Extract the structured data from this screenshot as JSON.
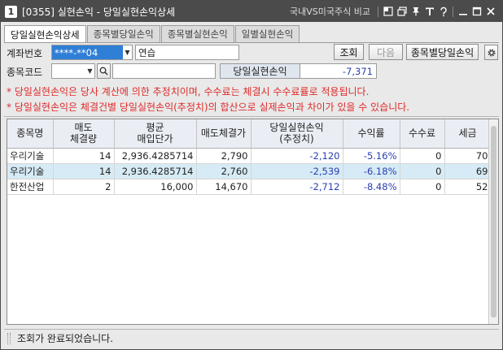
{
  "window": {
    "number": "1",
    "title": "[0355] 실현손익 - 당일실현손익상세",
    "compare_link": "국내VS미국주식 비교"
  },
  "tabs": [
    {
      "label": "당일실현손익상세",
      "active": true
    },
    {
      "label": "종목별당일손익",
      "active": false
    },
    {
      "label": "종목별실현손익",
      "active": false
    },
    {
      "label": "일별실현손익",
      "active": false
    }
  ],
  "form": {
    "account_label": "계좌번호",
    "account_value": "****-**04",
    "account_name": "연습",
    "code_label": "종목코드",
    "code_value": "",
    "code_name": "",
    "summary_label": "당일실현손익",
    "summary_value": "-7,371"
  },
  "buttons": {
    "query": "조회",
    "next": "다음",
    "by_stock": "종목별당일손익"
  },
  "notices": [
    "* 당일실현손익은 당사 계산에 의한 추정치이며, 수수료는 체결시 수수료률로 적용됩니다.",
    "* 당일실현손익은 체결건별 당일실현손익(추정치)의 합산으로 실제손익과 차이가 있을 수 있습니다."
  ],
  "table": {
    "headers": [
      [
        "종목명"
      ],
      [
        "매도",
        "체결량"
      ],
      [
        "평균",
        "매입단가"
      ],
      [
        "매도체결가"
      ],
      [
        "당일실현손익",
        "(추정치)"
      ],
      [
        "수익률"
      ],
      [
        "수수료"
      ],
      [
        "세금"
      ]
    ],
    "rows": [
      [
        "우리기술",
        "14",
        "2,936.4285714",
        "2,790",
        "-2,120",
        "-5.16%",
        "0",
        "70"
      ],
      [
        "우리기술",
        "14",
        "2,936.4285714",
        "2,760",
        "-2,539",
        "-6.18%",
        "0",
        "69"
      ],
      [
        "한전산업",
        "2",
        "16,000",
        "14,670",
        "-2,712",
        "-8.48%",
        "0",
        "52"
      ]
    ]
  },
  "status": {
    "message": "조회가 완료되었습니다."
  },
  "colors": {
    "titlebar": "#4b4b4b",
    "account_highlight": "#2f7fd6",
    "notice_red": "#e02a2a",
    "negative_blue": "#2a3fb0",
    "alt_row": "#d6ebf5"
  }
}
